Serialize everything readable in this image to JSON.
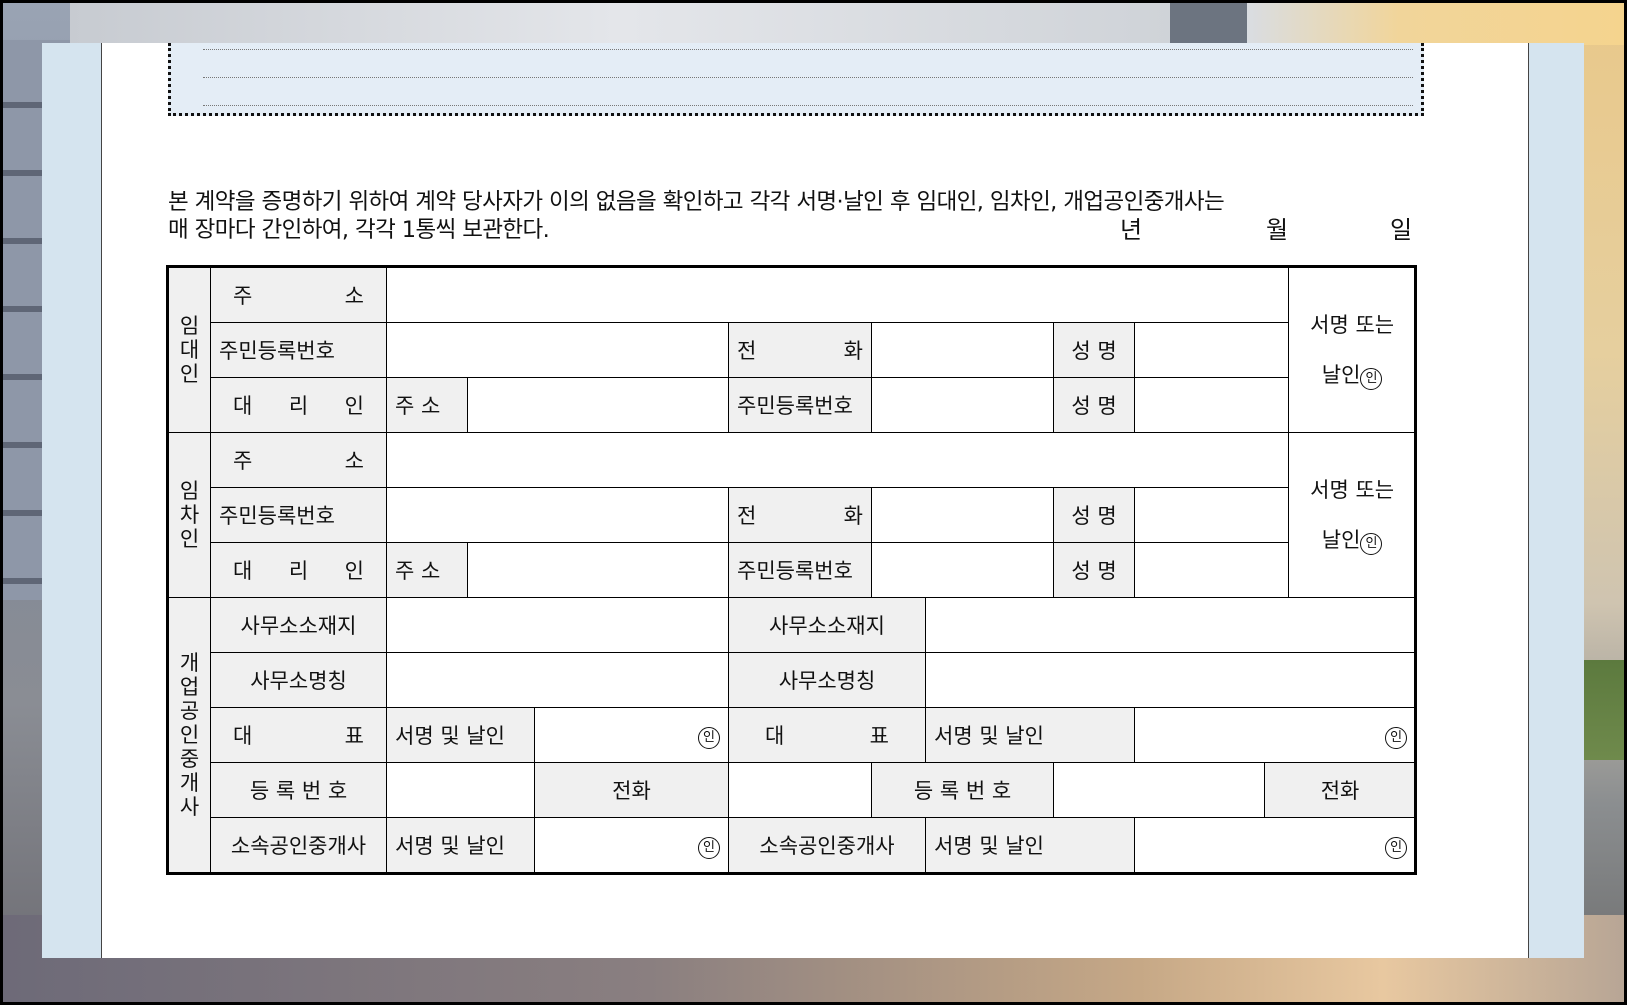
{
  "statement": {
    "line1": "본 계약을 증명하기 위하여 계약 당사자가 이의 없음을 확인하고 각각 서명·날인 후 임대인, 임차인, 개업공인중개사는",
    "line2": "매 장마다 간인하여, 각각 1통씩 보관한다.",
    "year": "년",
    "month": "월",
    "day": "일"
  },
  "landlord": {
    "group": [
      "임",
      "대",
      "인"
    ],
    "address_label": [
      "주",
      "소"
    ],
    "resident_no_label": "주민등록번호",
    "phone_label": [
      "전",
      "화"
    ],
    "name_label": "성 명",
    "agent_label": [
      "대",
      "리",
      "인"
    ],
    "agent_address_label": "주 소",
    "agent_resident_no_label": "주민등록번호",
    "agent_name_label": "성 명",
    "sign_label_1": "서명 또는",
    "sign_label_2": "날인"
  },
  "tenant": {
    "group": [
      "임",
      "차",
      "인"
    ],
    "address_label": [
      "주",
      "소"
    ],
    "resident_no_label": "주민등록번호",
    "phone_label": [
      "전",
      "화"
    ],
    "name_label": "성 명",
    "agent_label": [
      "대",
      "리",
      "인"
    ],
    "agent_address_label": "주 소",
    "agent_resident_no_label": "주민등록번호",
    "agent_name_label": "성 명",
    "sign_label_1": "서명 또는",
    "sign_label_2": "날인"
  },
  "broker": {
    "group": [
      "개",
      "업",
      "공",
      "인",
      "중",
      "개",
      "사"
    ],
    "office_location_label": "사무소소재지",
    "office_name_label": "사무소명칭",
    "representative_label": [
      "대",
      "표"
    ],
    "sign_seal_label": "서명 및 날인",
    "registration_label": "등 록 번 호",
    "phone_label": "전화",
    "affiliated_label": "소속공인중개사",
    "seal_mark": "인"
  }
}
